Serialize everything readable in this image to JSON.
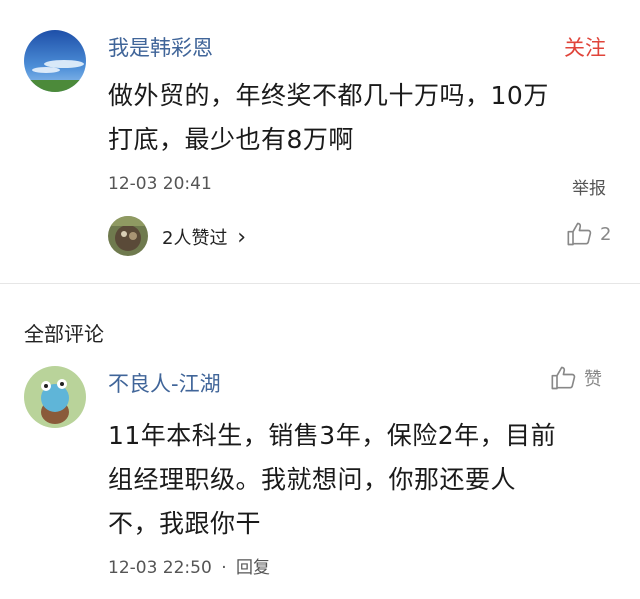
{
  "post": {
    "author": "我是韩彩恩",
    "follow_label": "关注",
    "content_line1": "做外贸的，年终奖不都几十万吗，10万",
    "content_line2": "打底，最少也有8万啊",
    "timestamp": "12-03 20:41",
    "report_label": "举报",
    "likers_label": "2人赞过",
    "likers_chevron": "›",
    "like_count": "2",
    "colors": {
      "name": "#406599",
      "follow": "#e0443a"
    }
  },
  "section": {
    "title": "全部评论"
  },
  "comment": {
    "author": "不良人-江湖",
    "like_label": "赞",
    "content_line1": "11年本科生，销售3年，保险2年，目前",
    "content_line2": "组经理职级。我就想问，你那还要人",
    "content_line3": "不，我跟你干",
    "timestamp": "12-03 22:50",
    "separator": "·",
    "reply_label": "回复"
  }
}
